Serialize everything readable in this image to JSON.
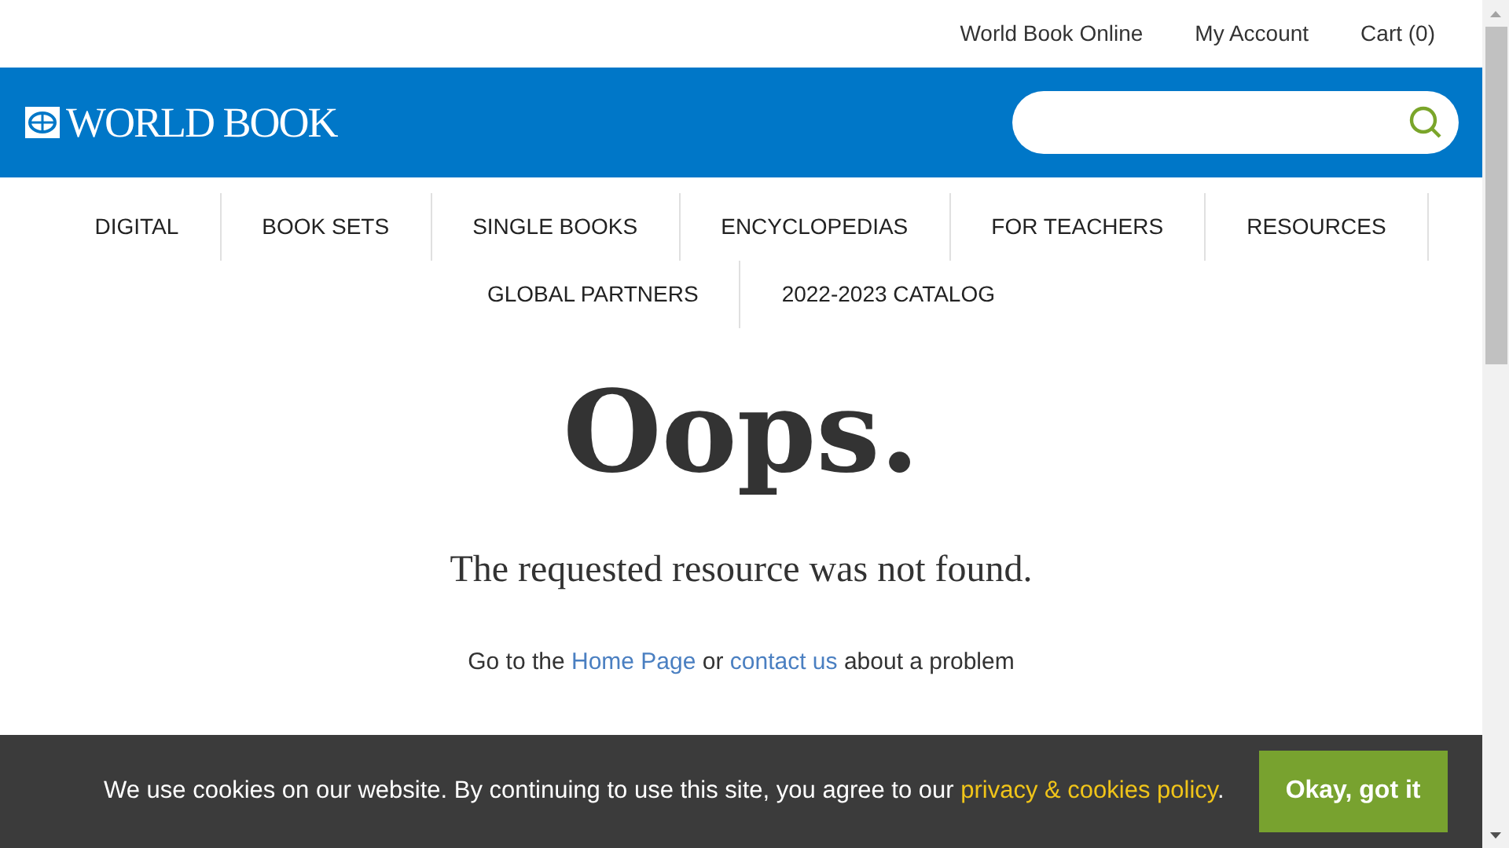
{
  "top_links": [
    "World Book Online",
    "My Account",
    "Cart (0)"
  ],
  "logo": {
    "text": "WORLD BOOK"
  },
  "nav_rows": [
    [
      "DIGITAL",
      "BOOK SETS",
      "SINGLE BOOKS",
      "ENCYCLOPEDIAS",
      "FOR TEACHERS",
      "RESOURCES"
    ],
    [
      "GLOBAL PARTNERS",
      "2022-2023 CATALOG"
    ]
  ],
  "heading": "Oops.",
  "message": "The requested resource was not found.",
  "help": {
    "before": "Go to the ",
    "link1": "Home Page",
    "middle": " or ",
    "link2": "contact us",
    "after": " about a problem"
  },
  "cookie_banner": {
    "text": "We use cookies on our website. By continuing to use this site, you agree to our ",
    "link": "privacy & cookies policy",
    "after": ".",
    "button": "Okay, got it"
  }
}
